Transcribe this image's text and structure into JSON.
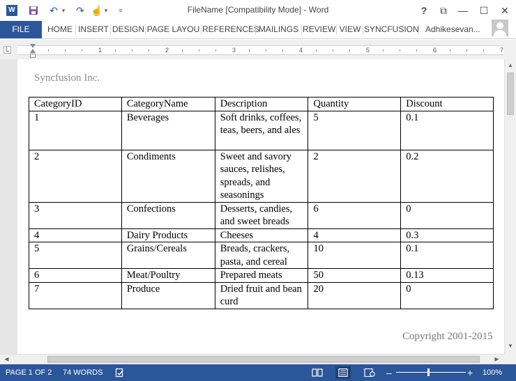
{
  "window": {
    "title": "FileName [Compatibility Mode] - Word",
    "help_glyph": "?",
    "restore_glyph": "⧉",
    "minimize_glyph": "—",
    "maximize_glyph": "☐",
    "close_glyph": "✕"
  },
  "qat": {
    "logo_letter": "W",
    "save_glyph": "💾",
    "undo_glyph": "↶",
    "undo_dropdown": "▾",
    "redo_glyph": "↷",
    "touch_glyph": "☝",
    "touch_dropdown": "▾",
    "customize_glyph": "≡"
  },
  "ribbon": {
    "file_label": "FILE",
    "tabs": [
      "HOME",
      "INSERT",
      "DESIGN",
      "PAGE LAYOU",
      "REFERENCES",
      "MAILINGS",
      "REVIEW",
      "VIEW",
      "SYNCFUSION"
    ],
    "user_name": "Adhikesevan..."
  },
  "ruler": {
    "corner_glyph": "L",
    "numbers": [
      "1",
      "2",
      "3",
      "4",
      "5",
      "6",
      "7"
    ]
  },
  "document": {
    "header": "Syncfusion Inc.",
    "footer": "Copyright 2001-2015",
    "table": {
      "columns": [
        "CategoryID",
        "CategoryName",
        "Description",
        "Quantity",
        "Discount"
      ],
      "rows": [
        [
          "1",
          "Beverages",
          "Soft drinks, coffees, teas, beers, and ales",
          "5",
          "0.1"
        ],
        [
          "2",
          "Condiments",
          "Sweet and savory sauces, relishes, spreads, and seasonings",
          "2",
          "0.2"
        ],
        [
          "3",
          "Confections",
          "Desserts, candies, and sweet breads",
          "6",
          "0"
        ],
        [
          "4",
          "Dairy Products",
          "Cheeses",
          "4",
          "0.3"
        ],
        [
          "5",
          "Grains/Cereals",
          "Breads, crackers, pasta, and cereal",
          "10",
          "0.1"
        ],
        [
          "6",
          "Meat/Poultry",
          "Prepared meats",
          "50",
          "0.13"
        ],
        [
          "7",
          "Produce",
          "Dried fruit and bean curd",
          "20",
          "0"
        ]
      ]
    }
  },
  "scrollbars": {
    "up_glyph": "▲",
    "down_glyph": "▼",
    "left_glyph": "◀",
    "right_glyph": "▶"
  },
  "statusbar": {
    "page": "PAGE 1 OF 2",
    "words": "74 WORDS",
    "proofing_glyph": "📖",
    "read_mode_glyph": "📖",
    "print_layout_glyph": "▤",
    "web_layout_glyph": "🌐",
    "zoom_out": "–",
    "zoom_in": "+",
    "zoom": "100%"
  }
}
